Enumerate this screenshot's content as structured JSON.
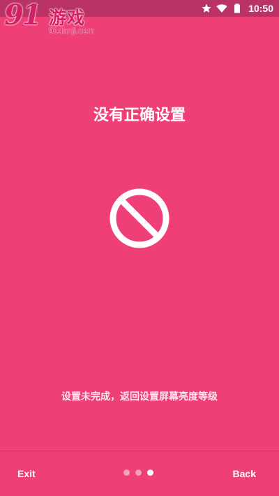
{
  "status_bar": {
    "time": "10:50",
    "icons": [
      "star-icon",
      "wifi-icon",
      "battery-icon"
    ]
  },
  "watermark": {
    "number": "91",
    "title": "游戏",
    "url": "91danji.com"
  },
  "main": {
    "title": "没有正确设置",
    "icon": "prohibited-icon",
    "message": "设置未完成，返回设置屏幕亮度等级"
  },
  "footer": {
    "exit_label": "Exit",
    "back_label": "Back",
    "page_indicator": {
      "total": 3,
      "current": 3
    }
  },
  "colors": {
    "background": "#ee4077",
    "status_bar": "#b93464",
    "text": "#ffffff"
  }
}
